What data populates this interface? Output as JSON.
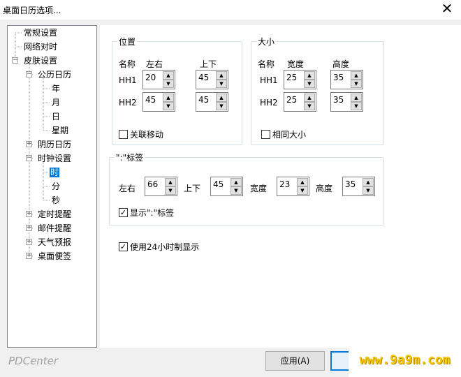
{
  "window": {
    "title": "桌面日历选项..."
  },
  "tree": [
    {
      "label": "常规设置"
    },
    {
      "label": "网络对时"
    },
    {
      "label": "皮肤设置"
    },
    {
      "label": "公历日历"
    },
    {
      "label": "年"
    },
    {
      "label": "月"
    },
    {
      "label": "日"
    },
    {
      "label": "星期"
    },
    {
      "label": "阴历日历"
    },
    {
      "label": "时钟设置"
    },
    {
      "label": "时"
    },
    {
      "label": "分"
    },
    {
      "label": "秒"
    },
    {
      "label": "定时提醒"
    },
    {
      "label": "邮件提醒"
    },
    {
      "label": "天气预报"
    },
    {
      "label": "桌面便签"
    }
  ],
  "position_group": {
    "title": "位置",
    "col_name": "名称",
    "col_lr": "左右",
    "col_ud": "上下",
    "rows": [
      {
        "name": "HH1",
        "lr": "20",
        "ud": "45"
      },
      {
        "name": "HH2",
        "lr": "45",
        "ud": "45"
      }
    ],
    "linked_move": "关联移动"
  },
  "size_group": {
    "title": "大小",
    "col_name": "名称",
    "col_w": "宽度",
    "col_h": "高度",
    "rows": [
      {
        "name": "HH1",
        "w": "25",
        "h": "35"
      },
      {
        "name": "HH2",
        "w": "25",
        "h": "35"
      }
    ],
    "same_size": "相同大小"
  },
  "label_group": {
    "title": "\":\"标签",
    "lr_label": "左右",
    "lr": "66",
    "ud_label": "上下",
    "ud": "45",
    "w_label": "宽度",
    "w": "23",
    "h_label": "高度",
    "h": "35",
    "show": "显示\":\"标签"
  },
  "use_24h": "使用24小时制显示",
  "footer": {
    "brand": "PDCenter",
    "apply": "应用(A)",
    "watermark": "www.9a9m.com"
  }
}
